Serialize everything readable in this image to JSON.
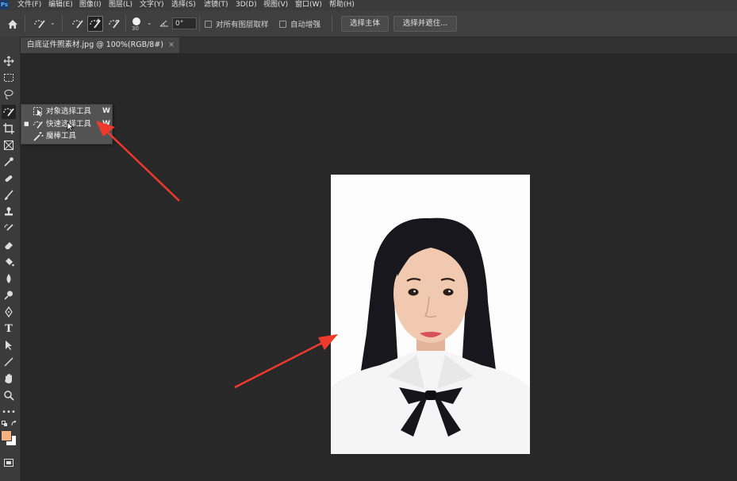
{
  "menubar": {
    "logo": "Ps",
    "items": [
      "文件(F)",
      "编辑(E)",
      "图像(I)",
      "图层(L)",
      "文字(Y)",
      "选择(S)",
      "滤镜(T)",
      "3D(D)",
      "视图(V)",
      "窗口(W)",
      "帮助(H)"
    ]
  },
  "options": {
    "brush_size": "30",
    "angle": "0°",
    "sample_all_layers": "对所有图层取样",
    "auto_enhance": "自动增强",
    "select_subject": "选择主体",
    "select_and_mask": "选择并遮住..."
  },
  "document": {
    "tab_title": "白底证件照素材.jpg @ 100%(RGB/8#)",
    "close_glyph": "×"
  },
  "flyout": {
    "items": [
      {
        "label": "对象选择工具",
        "key": "W",
        "current": false
      },
      {
        "label": "快速选择工具",
        "key": "W",
        "current": true
      },
      {
        "label": "魔棒工具",
        "key": "",
        "current": false
      }
    ],
    "bullet": "■"
  },
  "colors": {
    "foreground": "#f4b183",
    "background": "#ffffff",
    "annotation": "#ee3a2c"
  },
  "icons": [
    "home-icon",
    "quick-select-icon",
    "brush-preset-icon",
    "angle-icon",
    "move-icon",
    "marquee-icon",
    "lasso-icon",
    "crop-icon",
    "frame-icon",
    "eyedropper-icon",
    "healing-icon",
    "brush-icon",
    "stamp-icon",
    "history-brush-icon",
    "eraser-icon",
    "bucket-icon",
    "blur-icon",
    "dodge-icon",
    "pen-icon",
    "type-icon",
    "path-select-icon",
    "line-icon",
    "hand-icon",
    "zoom-icon",
    "more-icon",
    "screen-mode-icon"
  ]
}
